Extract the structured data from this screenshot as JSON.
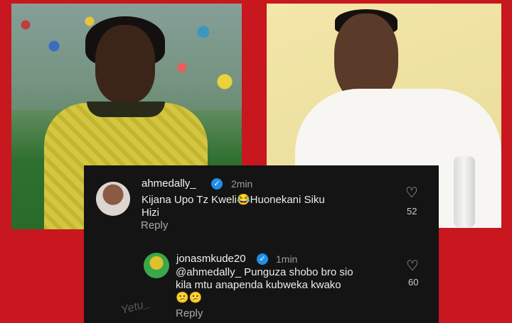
{
  "comments": [
    {
      "username": "ahmedally_",
      "verified_icon": "✓",
      "time": "2min",
      "text_line1": "Kijana Upo Tz Kweli",
      "emoji1": "😂",
      "text_line1b": "Huonekani Siku",
      "text_line2": "Hizi",
      "reply_label": "Reply",
      "likes": "52",
      "heart_icon": "♡"
    },
    {
      "username": "jonasmkude20",
      "verified_icon": "✓",
      "time": "1min",
      "text_line1": "@ahmedally_  Punguza shobo bro sio",
      "text_line2": "kila mtu anapenda kubweka kwako",
      "emoji_row": "😕😕",
      "reply_label": "Reply",
      "likes": "60",
      "heart_icon": "♡"
    }
  ],
  "watermark": "Yetu_",
  "colors": {
    "background": "#c8171e",
    "card": "#141414",
    "verified": "#1f8fe9"
  }
}
